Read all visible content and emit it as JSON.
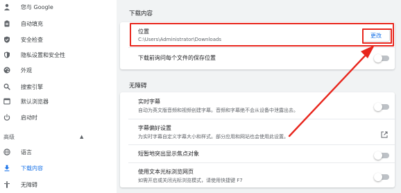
{
  "sidebar": {
    "items": [
      {
        "label": "您与 Google",
        "icon": "person-icon"
      },
      {
        "label": "自动填充",
        "icon": "clipboard-icon"
      },
      {
        "label": "安全检查",
        "icon": "shield-check-icon"
      },
      {
        "label": "隐私设置和安全性",
        "icon": "shield-icon"
      },
      {
        "label": "外观",
        "icon": "palette-icon"
      },
      {
        "label": "搜索引擎",
        "icon": "search-icon"
      },
      {
        "label": "默认浏览器",
        "icon": "browser-icon"
      },
      {
        "label": "启动时",
        "icon": "power-icon"
      }
    ],
    "advanced_label": "高级",
    "advanced_items": [
      {
        "label": "语言",
        "icon": "globe-icon"
      },
      {
        "label": "下载内容",
        "icon": "download-icon",
        "active": true
      },
      {
        "label": "无障碍",
        "icon": "accessibility-icon"
      }
    ]
  },
  "downloads": {
    "section_title": "下载内容",
    "location_label": "位置",
    "location_path": "C:\\Users\\Administrator\\Downloads",
    "change_button": "更改",
    "ask_label": "下载前询问每个文件的保存位置",
    "ask_enabled": false
  },
  "accessibility": {
    "section_title": "无障碍",
    "live_caption_title": "实时字幕",
    "live_caption_sub": "自动为英文版音频和视频创建字幕。音频和字幕绝不会从设备中泄露出去。",
    "live_caption_enabled": false,
    "caption_pref_title": "字幕偏好设置",
    "caption_pref_sub": "为实时字幕自定义字幕大小和样式。部分应用和网站也会使用此设置。",
    "focus_highlight_label": "短暂地突出显示焦点对象",
    "focus_highlight_enabled": false,
    "caret_browsing_title": "使用文本光标浏览网页",
    "caret_browsing_sub": "如需开启或关闭光标浏览模式，请使用快捷键 F7",
    "caret_browsing_enabled": false
  },
  "colors": {
    "accent": "#1a73e8",
    "annotation_red": "#e8261d"
  }
}
